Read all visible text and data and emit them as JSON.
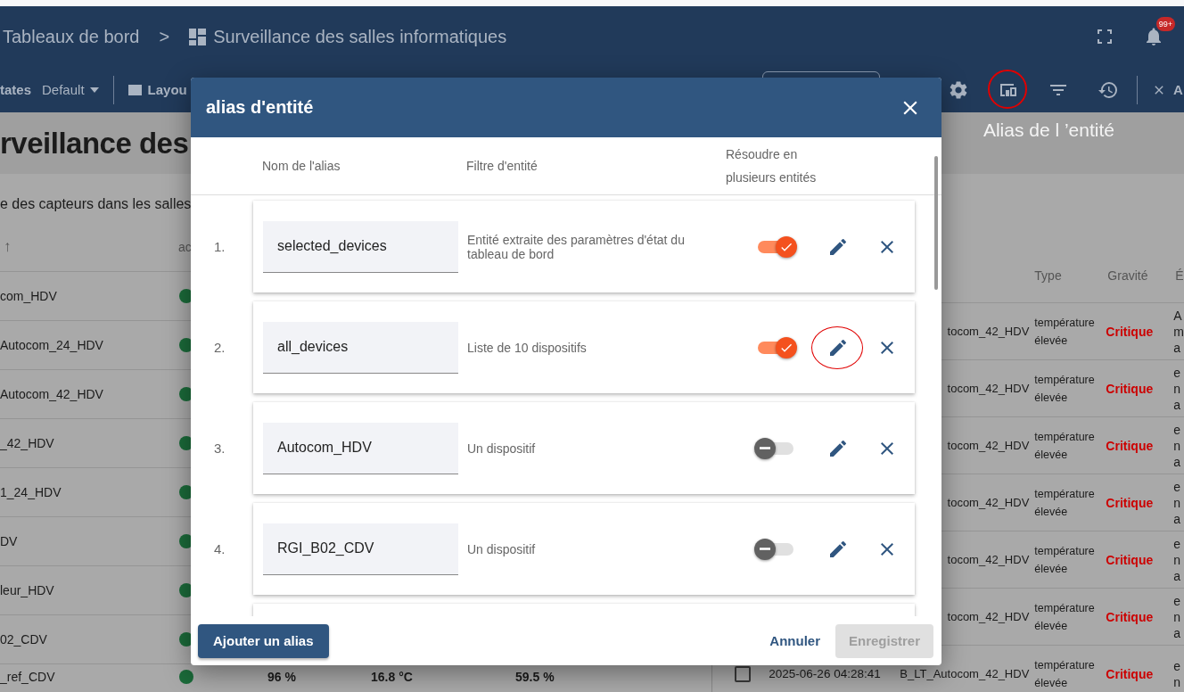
{
  "breadcrumb": {
    "items": [
      "Tableaux de bord",
      "Surveillance des salles informatiques"
    ],
    "separator": ">"
  },
  "notifications": {
    "badge": "99+"
  },
  "toolbar": {
    "states_label": "tates",
    "state_value": "Default",
    "layout_label": "Layou",
    "icons": [
      {
        "kind": "settings",
        "highlighted": false
      },
      {
        "kind": "devices",
        "highlighted": true
      },
      {
        "kind": "filter",
        "highlighted": false
      },
      {
        "kind": "history",
        "highlighted": false
      }
    ],
    "close_label": "A"
  },
  "dashboard": {
    "title": "rveillance des",
    "annotation": "Alias de l ’entité",
    "subtitle": "e des capteurs dans les salles",
    "devices": {
      "columns": [
        "↑",
        "ac"
      ],
      "rows": [
        {
          "name": "com_HDV"
        },
        {
          "name": "Autocom_24_HDV"
        },
        {
          "name": "Autocom_42_HDV"
        },
        {
          "name": "_42_HDV"
        },
        {
          "name": "1_24_HDV"
        },
        {
          "name": "DV"
        },
        {
          "name": "leur_HDV"
        },
        {
          "name": "02_CDV"
        },
        {
          "name": "_ref_CDV",
          "values": [
            "96 %",
            "16.8 °C",
            "59.5 %"
          ]
        }
      ]
    },
    "alarms": {
      "columns": [
        "Type",
        "Gravité",
        "É"
      ],
      "rows": [
        {
          "device": "tocom_42_HDV",
          "type": "température élevée",
          "severity": "Critique",
          "column_6": "A\nm\na"
        },
        {
          "device": "tocom_42_HDV",
          "type": "température élevée",
          "severity": "Critique",
          "column_6": "e\nn\na"
        },
        {
          "device": "tocom_42_HDV",
          "type": "température élevée",
          "severity": "Critique",
          "column_6": "e\nn\na"
        },
        {
          "device": "tocom_42_HDV",
          "type": "température élevée",
          "severity": "Critique",
          "column_6": "e\nn\na"
        },
        {
          "device": "tocom_42_HDV",
          "type": "température élevée",
          "severity": "Critique",
          "column_6": "e\nn\na"
        },
        {
          "device": "tocom_42_HDV",
          "type": "température élevée",
          "severity": "Critique",
          "column_6": "e\nn\na"
        },
        {
          "checked": false,
          "date": "2025-06-26 04:28:41",
          "device": "B_LT_Autocom_42_HDV",
          "type": "température élevée",
          "severity": "Critique",
          "column_6": "e\nn"
        }
      ]
    }
  },
  "dialog": {
    "title": "alias d'entité",
    "columns": [
      "Nom de l'alias",
      "Filtre d'entité",
      "Résoudre en plusieurs entités"
    ],
    "aliases": [
      {
        "number": "1.",
        "name": "selected_devices",
        "filter": "Entité extraite des paramètres d'état du tableau de bord",
        "resolve_multiple": true,
        "highlighted": false
      },
      {
        "number": "2.",
        "name": "all_devices",
        "filter": "Liste de 10 dispositifs",
        "resolve_multiple": true,
        "highlighted": true
      },
      {
        "number": "3.",
        "name": "Autocom_HDV",
        "filter": "Un dispositif",
        "resolve_multiple": false,
        "highlighted": false
      },
      {
        "number": "4.",
        "name": "RGI_B02_CDV",
        "filter": "Un dispositif",
        "resolve_multiple": false,
        "highlighted": false
      }
    ],
    "add_button": "Ajouter un alias",
    "cancel_button": "Annuler",
    "save_button": {
      "label": "Enregistrer",
      "disabled": true
    }
  }
}
